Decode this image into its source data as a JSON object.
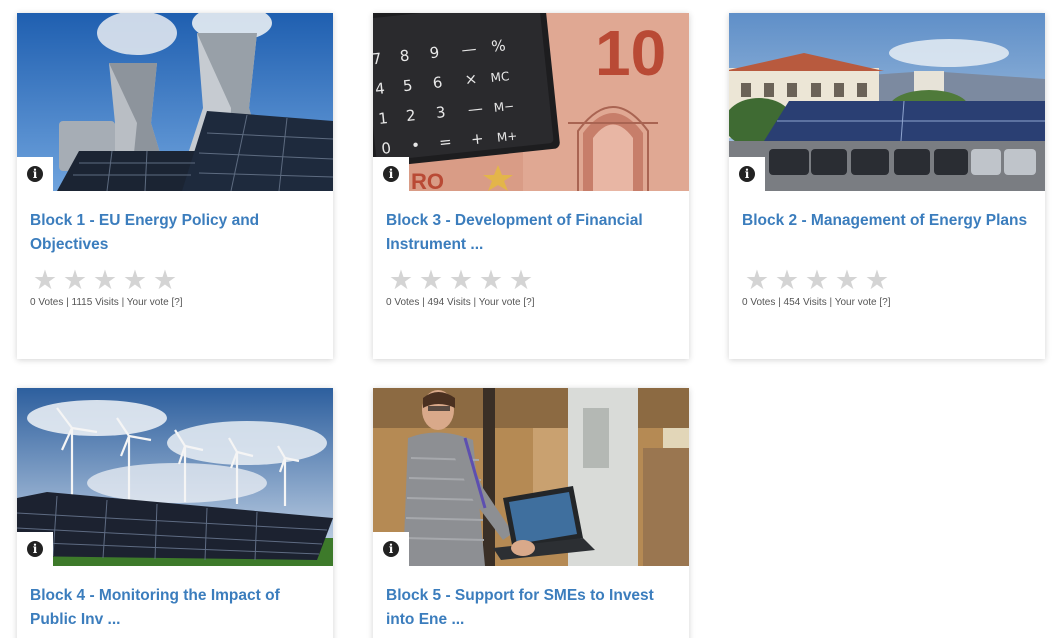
{
  "cards": [
    {
      "title": "Block 1 - EU Energy Policy and Objectives",
      "stats": {
        "votes": "0 Votes",
        "visits": "1115 Visits",
        "your_vote": "Your vote",
        "help": "[?]"
      },
      "rating": 0,
      "image": "cooling-towers-solar-panels"
    },
    {
      "title": "Block 3 - Development of Financial Instrument ...",
      "stats": {
        "votes": "0 Votes",
        "visits": "494 Visits",
        "your_vote": "Your vote",
        "help": "[?]"
      },
      "rating": 0,
      "image": "calculator-euro-banknote",
      "image_text": {
        "keys": [
          "7",
          "8",
          "9",
          "—",
          "%",
          "4",
          "5",
          "6",
          "×",
          "MC",
          "1",
          "2",
          "3",
          "—",
          "M−",
          "0",
          "•",
          "=",
          "+",
          "M+"
        ],
        "banknote_value": "10",
        "banknote_word": "RO"
      }
    },
    {
      "title": "Block 2 - Management of Energy Plans",
      "stats": {
        "votes": "0 Votes",
        "visits": "454 Visits",
        "your_vote": "Your vote",
        "help": "[?]"
      },
      "rating": 0,
      "image": "solar-carport-building"
    },
    {
      "title": "Block 4 - Monitoring the Impact of Public Inv ...",
      "image": "wind-turbines-solar-field"
    },
    {
      "title": "Block 5 - Support for SMEs to Invest into Ene ...",
      "image": "engineer-laptop-factory"
    }
  ],
  "star_glyph": "★",
  "info_glyph": "i",
  "separator": "|",
  "colors": {
    "title_link": "#3b7dbd",
    "star_empty": "#d4d4d4"
  }
}
